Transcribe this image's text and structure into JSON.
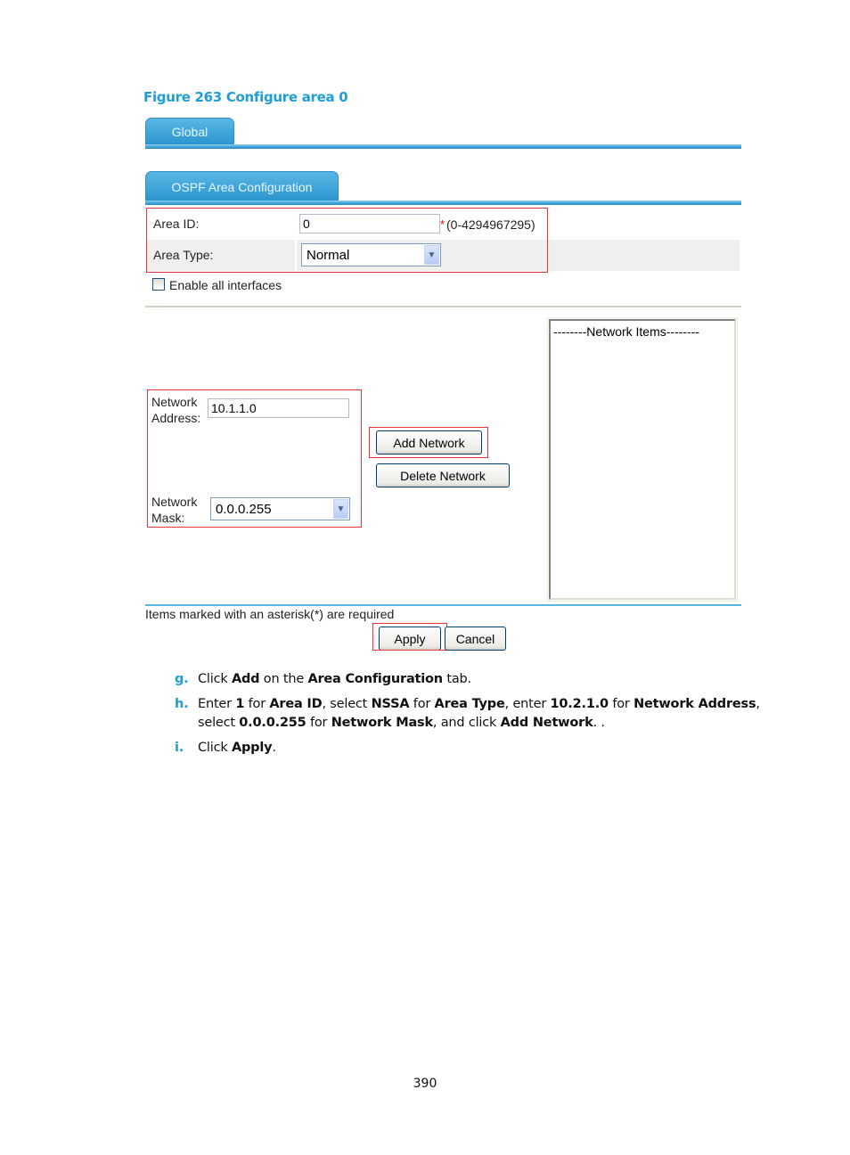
{
  "figure_caption": "Figure 263 Configure area 0",
  "tabs": {
    "global": "Global",
    "ospf_area": "OSPF Area Configuration"
  },
  "form": {
    "area_id": {
      "label": "Area ID:",
      "value": "0",
      "required_mark": "*",
      "range_hint": "(0-4294967295)"
    },
    "area_type": {
      "label": "Area Type:",
      "selected": "Normal"
    },
    "enable_all_interfaces": {
      "label": "Enable all interfaces",
      "checked": false
    },
    "network_address": {
      "label_line1": "Network",
      "label_line2": "Address:",
      "value": "10.1.1.0"
    },
    "network_mask": {
      "label_line1": "Network",
      "label_line2": "Mask:",
      "selected": "0.0.0.255"
    },
    "add_network_label": "Add Network",
    "delete_network_label": "Delete Network",
    "network_items_header": "--------Network Items--------",
    "required_note": "Items marked with an asterisk(*) are required",
    "apply_label": "Apply",
    "cancel_label": "Cancel"
  },
  "colors": {
    "accent": "#1f9ed6",
    "highlight_box": "#e8343a"
  },
  "steps": [
    {
      "marker": "g.",
      "parts": [
        {
          "t": "Click ",
          "b": false
        },
        {
          "t": "Add",
          "b": true
        },
        {
          "t": " on the ",
          "b": false
        },
        {
          "t": "Area Configuration",
          "b": true
        },
        {
          "t": " tab.",
          "b": false
        }
      ]
    },
    {
      "marker": "h.",
      "parts": [
        {
          "t": "Enter ",
          "b": false
        },
        {
          "t": "1",
          "b": true
        },
        {
          "t": " for ",
          "b": false
        },
        {
          "t": "Area ID",
          "b": true
        },
        {
          "t": ", select ",
          "b": false
        },
        {
          "t": "NSSA",
          "b": true
        },
        {
          "t": " for ",
          "b": false
        },
        {
          "t": "Area Type",
          "b": true
        },
        {
          "t": ", enter ",
          "b": false
        },
        {
          "t": "10.2.1.0",
          "b": true
        },
        {
          "t": " for ",
          "b": false
        },
        {
          "t": "Network Address",
          "b": true
        },
        {
          "t": ", select ",
          "b": false
        },
        {
          "t": "0.0.0.255",
          "b": true
        },
        {
          "t": " for ",
          "b": false
        },
        {
          "t": "Network Mask",
          "b": true
        },
        {
          "t": ", and click ",
          "b": false
        },
        {
          "t": "Add Network",
          "b": true
        },
        {
          "t": ". .",
          "b": false
        }
      ]
    },
    {
      "marker": "i.",
      "parts": [
        {
          "t": "Click ",
          "b": false
        },
        {
          "t": "Apply",
          "b": true
        },
        {
          "t": ".",
          "b": false
        }
      ]
    }
  ],
  "page_number": "390"
}
